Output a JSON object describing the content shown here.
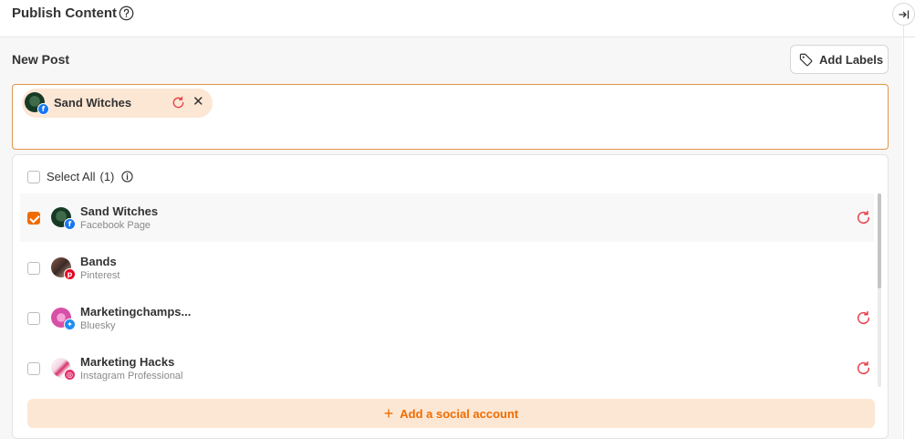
{
  "header": {
    "title": "Publish Content",
    "help_icon": "question-circle-icon",
    "collapse_icon": "collapse-right-icon"
  },
  "composer": {
    "section_title": "New Post",
    "add_labels_label": "Add Labels",
    "add_labels_icon": "tag-icon",
    "selected_chips": [
      {
        "label": "Sand Witches",
        "network": "facebook",
        "refresh_icon": "refresh-icon",
        "close_icon": "close-icon"
      }
    ]
  },
  "accounts": {
    "select_all_label": "Select All",
    "select_all_count": "(1)",
    "select_all_checked": false,
    "items": [
      {
        "name": "Sand Witches",
        "type": "Facebook Page",
        "checked": true,
        "network": "facebook",
        "badge_color": "#1877f2",
        "refresh": true
      },
      {
        "name": "Bands",
        "type": "Pinterest",
        "checked": false,
        "network": "pinterest",
        "badge_color": "#e60023",
        "refresh": false
      },
      {
        "name": "Marketingchamps...",
        "type": "Bluesky",
        "checked": false,
        "network": "bluesky",
        "badge_color": "#1d8cf5",
        "refresh": true
      },
      {
        "name": "Marketing Hacks",
        "type": "Instagram Professional",
        "checked": false,
        "network": "instagram",
        "badge_color": "#e1306c",
        "refresh": true
      }
    ],
    "add_account_label": "Add a social account"
  },
  "colors": {
    "accent": "#f06c00",
    "accent_light": "#fce7d4",
    "refresh_red": "#e8404a",
    "border_accent": "#e0974c"
  }
}
